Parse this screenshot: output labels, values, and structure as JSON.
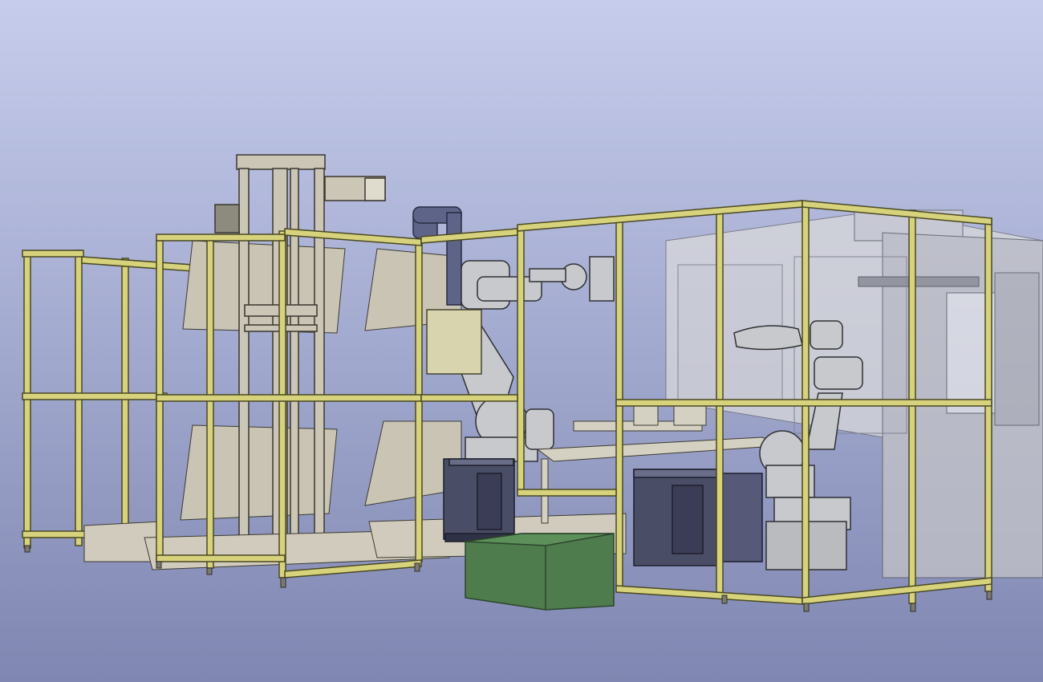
{
  "view": {
    "background_top": "#c6cdec",
    "background_bottom": "#7f87b2"
  },
  "colors": {
    "frame": "#d7d27c",
    "frame_edge": "#4a4823",
    "panel": "#c9c4b4",
    "panel_edge": "#3d3a31",
    "machine_glass": "#d2d2d4",
    "robot": "#c7c9cd",
    "robot_edge": "#2f3034",
    "duct": "#5d6487",
    "controller": "#4a4d66",
    "bin": "#4e7c4d",
    "bin_edge": "#2d442c",
    "control_box": "#d8d4ad"
  },
  "objects": {
    "left_cell_frame": "aluminium-frame",
    "center_cell_frame": "aluminium-frame",
    "right_cell_frame": "aluminium-frame",
    "lift_tower": "vertical-lift",
    "robot_a": "industrial-robot",
    "robot_b": "industrial-robot",
    "controller_a": "robot-controller",
    "controller_b": "robot-controller",
    "scrap_bin": "bin",
    "press_enclosure": "machine-enclosure"
  }
}
